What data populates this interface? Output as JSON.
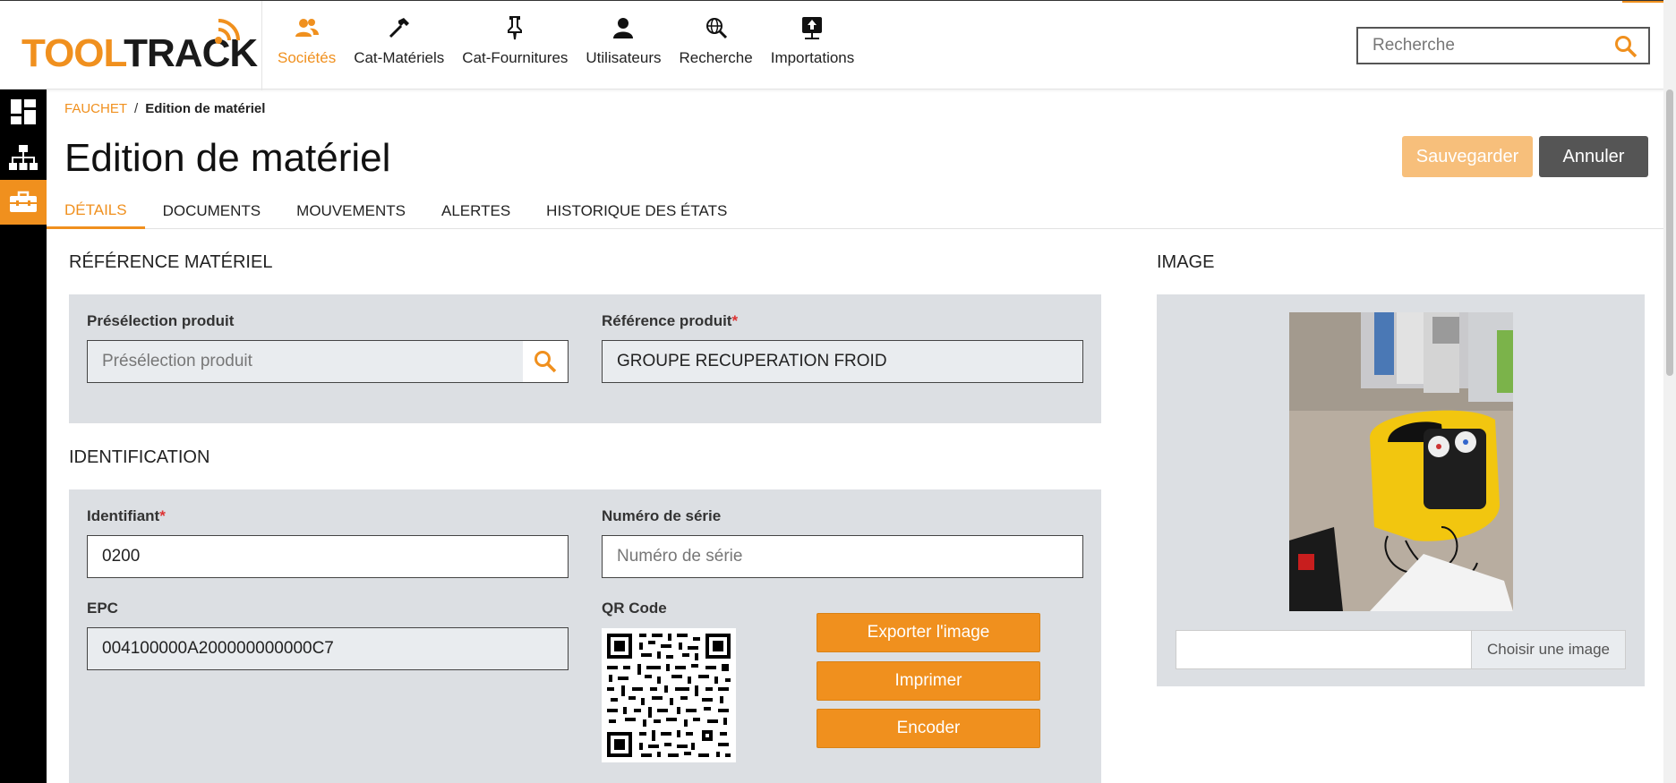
{
  "logo": {
    "part1": "TOOL",
    "part2": "TRACK"
  },
  "nav": {
    "items": [
      {
        "label": "Sociétés",
        "icon": "users-icon",
        "active": true
      },
      {
        "label": "Cat-Matériels",
        "icon": "hammer-icon",
        "active": false
      },
      {
        "label": "Cat-Fournitures",
        "icon": "pin-icon",
        "active": false
      },
      {
        "label": "Utilisateurs",
        "icon": "user-icon",
        "active": false
      },
      {
        "label": "Recherche",
        "icon": "globe-search-icon",
        "active": false
      },
      {
        "label": "Importations",
        "icon": "upload-icon",
        "active": false
      }
    ]
  },
  "search": {
    "placeholder": "Recherche",
    "value": ""
  },
  "sidebar": {
    "items": [
      "dashboard-icon",
      "hierarchy-icon",
      "toolbox-icon"
    ],
    "active_index": 2
  },
  "breadcrumb": {
    "parent": "FAUCHET",
    "separator": "/",
    "current": "Edition de matériel"
  },
  "page": {
    "title": "Edition de matériel"
  },
  "actions": {
    "save_label": "Sauvegarder",
    "cancel_label": "Annuler"
  },
  "tabs": [
    {
      "label": "DÉTAILS",
      "active": true
    },
    {
      "label": "DOCUMENTS",
      "active": false
    },
    {
      "label": "MOUVEMENTS",
      "active": false
    },
    {
      "label": "ALERTES",
      "active": false
    },
    {
      "label": "HISTORIQUE DES ÉTATS",
      "active": false
    }
  ],
  "reference": {
    "section_title": "RÉFÉRENCE MATÉRIEL",
    "preselection_label": "Présélection produit",
    "preselection_placeholder": "Présélection produit",
    "product_ref_label": "Référence produit",
    "product_ref_value": "GROUPE RECUPERATION FROID"
  },
  "identification": {
    "section_title": "IDENTIFICATION",
    "id_label": "Identifiant",
    "id_value": "0200",
    "serial_label": "Numéro de série",
    "serial_placeholder": "Numéro de série",
    "epc_label": "EPC",
    "epc_value": "004100000A200000000000C7",
    "qr_label": "QR Code",
    "export_label": "Exporter l'image",
    "print_label": "Imprimer",
    "encode_label": "Encoder"
  },
  "image": {
    "section_title": "IMAGE",
    "choose_label": "Choisir une image"
  },
  "required_marker": "*",
  "colors": {
    "accent": "#f0901e",
    "panel": "#dcdfe3",
    "sidebar": "#000000",
    "cancel": "#555555"
  }
}
